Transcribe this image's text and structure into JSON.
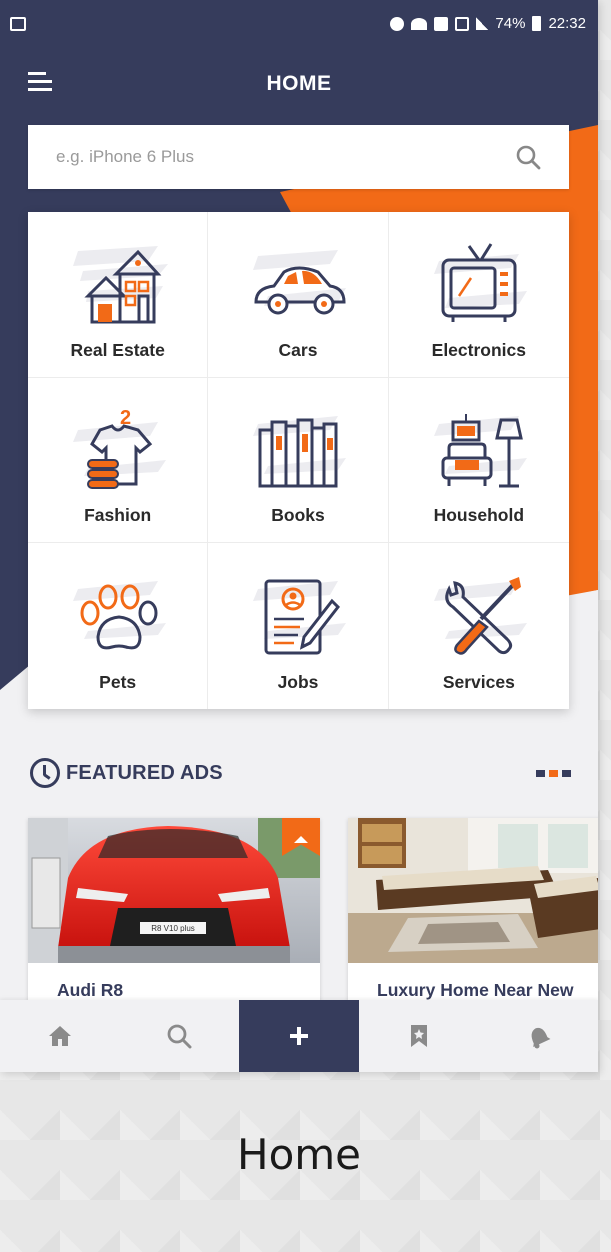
{
  "status_bar": {
    "battery_percent": "74%",
    "time": "22:32"
  },
  "app_bar": {
    "title": "HOME"
  },
  "search": {
    "placeholder": "e.g. iPhone 6 Plus"
  },
  "categories": [
    {
      "label": "Real Estate",
      "icon": "house-icon"
    },
    {
      "label": "Cars",
      "icon": "car-icon"
    },
    {
      "label": "Electronics",
      "icon": "tv-icon"
    },
    {
      "label": "Fashion",
      "icon": "tshirt-icon"
    },
    {
      "label": "Books",
      "icon": "books-icon"
    },
    {
      "label": "Household",
      "icon": "sofa-lamp-icon"
    },
    {
      "label": "Pets",
      "icon": "paw-icon"
    },
    {
      "label": "Jobs",
      "icon": "resume-icon"
    },
    {
      "label": "Services",
      "icon": "tools-icon"
    }
  ],
  "featured": {
    "title": "FEATURED ADS",
    "ads": [
      {
        "title": "Audi R8",
        "plate": "R8 V10 plus"
      },
      {
        "title": "Luxury Home Near New"
      }
    ]
  },
  "bottom_nav": [
    {
      "name": "home",
      "icon": "home-icon"
    },
    {
      "name": "search",
      "icon": "search-icon"
    },
    {
      "name": "add",
      "icon": "plus-icon"
    },
    {
      "name": "saved",
      "icon": "bookmark-icon"
    },
    {
      "name": "notifications",
      "icon": "bell-icon"
    }
  ],
  "caption": "Home",
  "colors": {
    "navy": "#363c5c",
    "orange": "#f26a17",
    "background": "#f1f1f3"
  }
}
